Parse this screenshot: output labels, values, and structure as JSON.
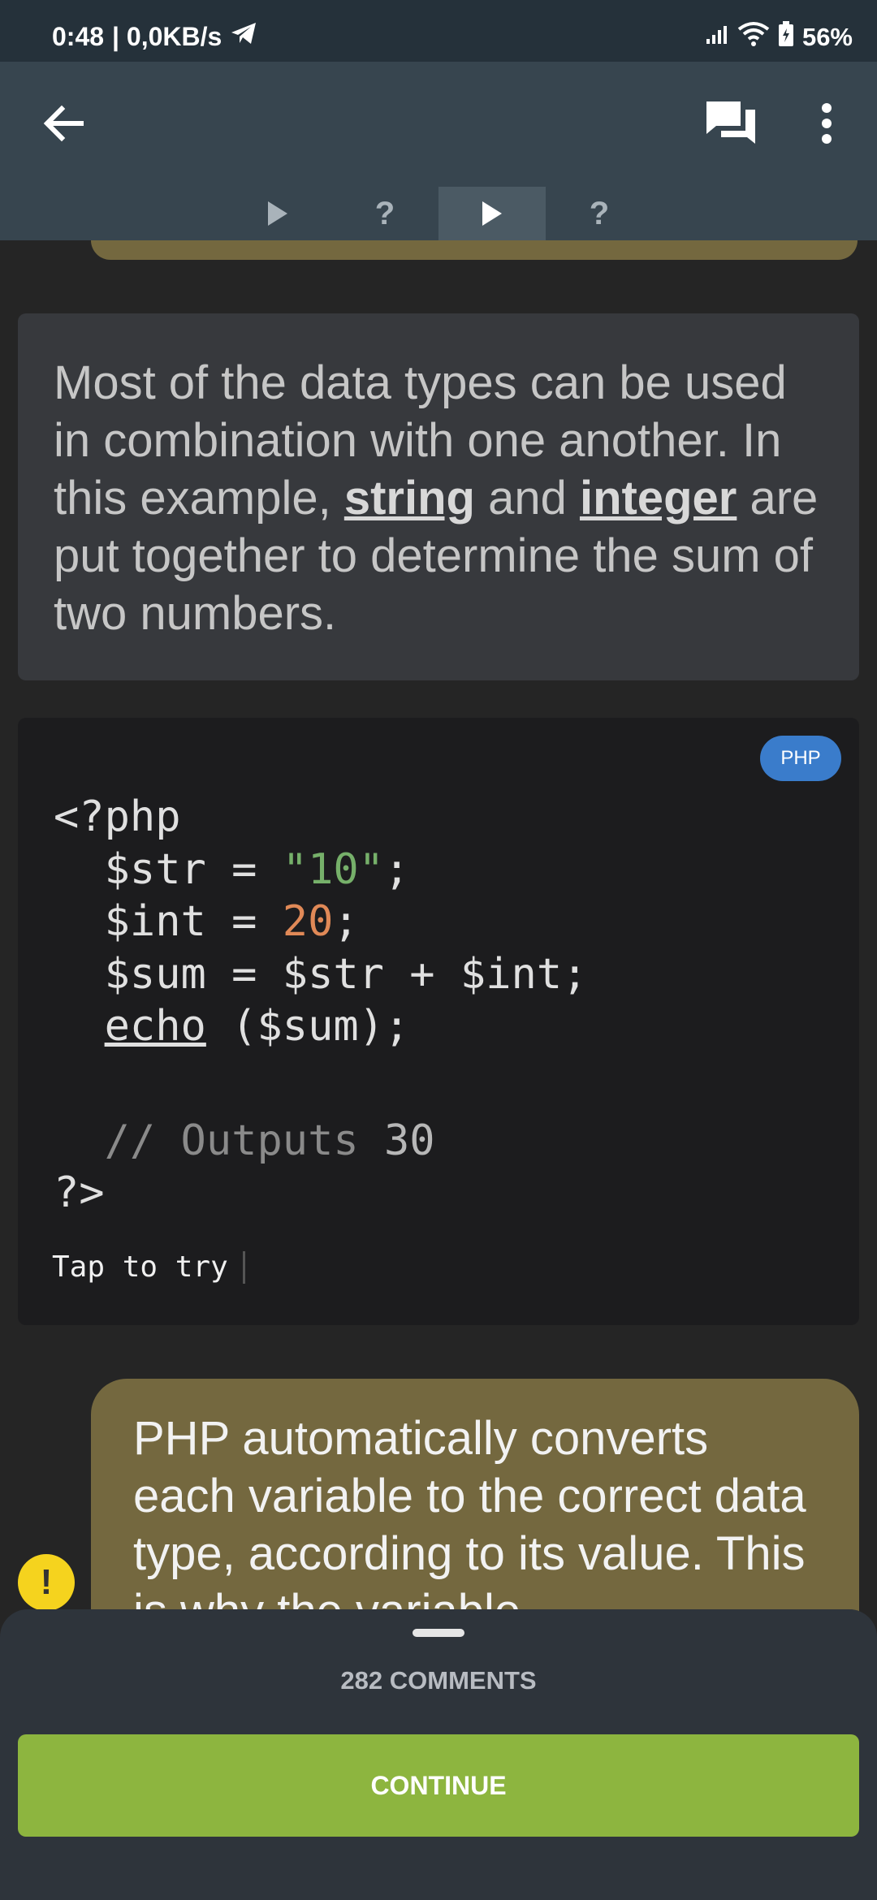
{
  "status_bar": {
    "time": "0:48",
    "network_speed": "| 0,0KB/s",
    "battery": "56%"
  },
  "toolbar": {
    "back_icon": "arrow-left-icon",
    "comments_icon": "chat-bubbles-icon",
    "more_icon": "more-vertical-icon"
  },
  "lesson_tabs": [
    {
      "icon": "play-icon",
      "label": ""
    },
    {
      "label": "?"
    },
    {
      "icon": "play-icon",
      "label": "",
      "active": true
    },
    {
      "label": "?"
    }
  ],
  "text_card": {
    "part1": "Most of the data types can be used in combination with one another. In this example, ",
    "kw1": "string",
    "part2": " and ",
    "kw2": "integer",
    "part3": " are put together to determine the sum of two numbers."
  },
  "code_card": {
    "language": "PHP",
    "lines": {
      "l1": "<?php",
      "l2_a": "  $str = ",
      "l2_str": "\"10\"",
      "l2_b": ";",
      "l3_a": "  $int = ",
      "l3_num": "20",
      "l3_b": ";",
      "l4": "  $sum = $str + $int;",
      "l5_indent": "  ",
      "l5_fn": "echo",
      "l5_b": " ($sum);",
      "l7_a": "  // Outputs ",
      "l7_num": "30",
      "l8": "?>"
    },
    "tap_to_try": "Tap to try"
  },
  "bubble": {
    "text": "PHP automatically converts each variable to the correct data type, according to its value. This is why the variable"
  },
  "bottom_sheet": {
    "comments_label": "282 COMMENTS",
    "continue_label": "CONTINUE"
  },
  "colors": {
    "accent_green": "#8db53f",
    "bubble_olive": "#74683f",
    "badge_blue": "#3a7ccb",
    "string_green": "#76b06a",
    "number_orange": "#e08957"
  }
}
